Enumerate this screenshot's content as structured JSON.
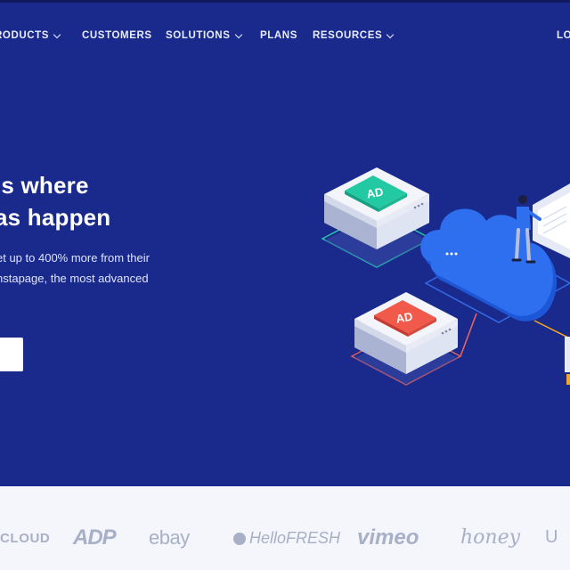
{
  "nav": {
    "products": "RODUCTS",
    "customers": "CUSTOMERS",
    "solutions": "SOLUTIONS",
    "plans": "PLANS",
    "resources": "RESOURCES",
    "login": "LO"
  },
  "hero": {
    "headline_line1": "is where",
    "headline_line2": "as happen",
    "sub_line1": "et up to 400% more from their",
    "sub_line2": "nstapage, the most advanced",
    "sub_line3": "."
  },
  "illustration": {
    "ad_top_label": "AD",
    "ad_bottom_label": "AD"
  },
  "logos": {
    "cloud": "CLOUD",
    "adp": "ADP",
    "ebay": "ebay",
    "hellofresh": "HelloFRESH",
    "vimeo": "vimeo",
    "honey": "honey",
    "partial": "U"
  },
  "colors": {
    "hero_bg": "#1a2a8c",
    "ad_top": "#22c9a3",
    "ad_bottom": "#f15a4a",
    "cloud": "#2e6ff0"
  }
}
